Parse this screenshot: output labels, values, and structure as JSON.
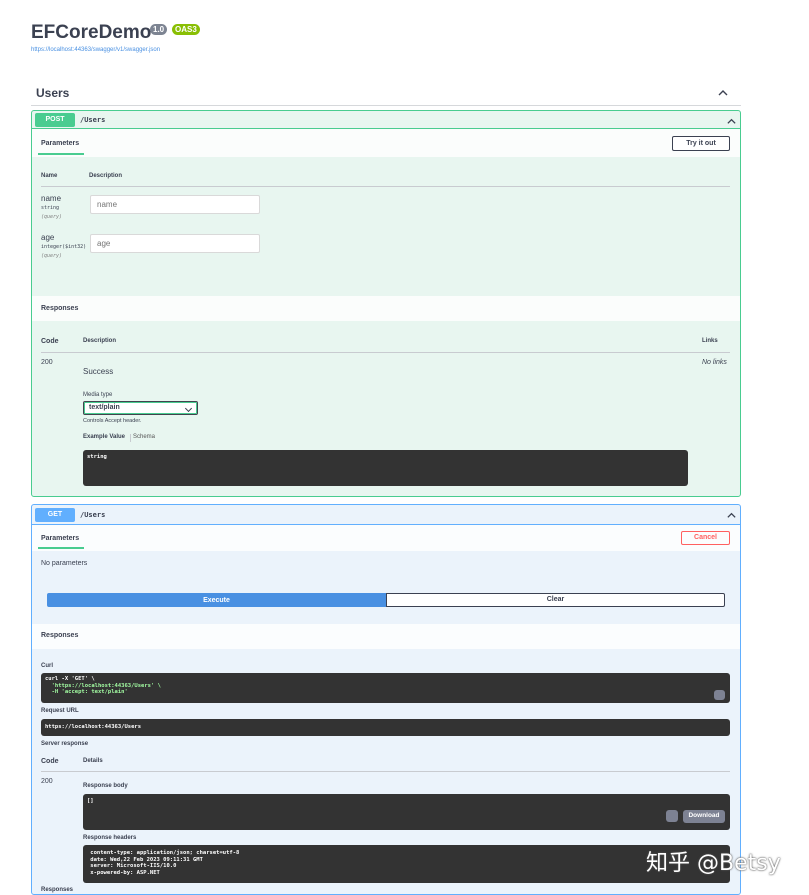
{
  "header": {
    "title": "EFCoreDemo",
    "version_badge": "1.0",
    "oas_badge": "OAS3",
    "spec_url": "https://localhost:44363/swagger/v1/swagger.json"
  },
  "tag": {
    "name": "Users"
  },
  "post_op": {
    "method": "POST",
    "path": "/Users",
    "params_tab": "Parameters",
    "try_button": "Try it out",
    "col_name": "Name",
    "col_description": "Description",
    "params": [
      {
        "name": "name",
        "type": "string",
        "in": "(query)",
        "placeholder": "name"
      },
      {
        "name": "age",
        "type": "integer($int32)",
        "in": "(query)",
        "placeholder": "age"
      }
    ],
    "responses_title": "Responses",
    "col_code": "Code",
    "col_resp_description": "Description",
    "col_links": "Links",
    "response": {
      "code": "200",
      "description": "Success",
      "links": "No links",
      "media_type_label": "Media type",
      "media_type_value": "text/plain",
      "controls_hint": "Controls Accept header.",
      "example_tab": "Example Value",
      "schema_tab": "Schema",
      "example": "string"
    }
  },
  "get_op": {
    "method": "GET",
    "path": "/Users",
    "params_tab": "Parameters",
    "cancel_button": "Cancel",
    "no_params": "No parameters",
    "execute_button": "Execute",
    "clear_button": "Clear",
    "responses_title": "Responses",
    "curl_label": "Curl",
    "curl_line1": "curl -X 'GET' \\",
    "curl_line2": "  'https://localhost:44363/Users' \\",
    "curl_line3": "  -H 'accept: text/plain'",
    "request_url_label": "Request URL",
    "request_url": "https://localhost:44363/Users",
    "server_response_label": "Server response",
    "col_code": "Code",
    "col_details": "Details",
    "code": "200",
    "response_body_label": "Response body",
    "response_body": "[]",
    "download_button": "Download",
    "response_headers_label": "Response headers",
    "headers_line1": " content-type: application/json; charset=utf-8",
    "headers_line2": " date: Wed,22 Feb 2023 09:11:31 GMT",
    "headers_line3": " server: Microsoft-IIS/10.0",
    "headers_line4": " x-powered-by: ASP.NET",
    "bottom_responses": "Responses"
  },
  "watermark": "知乎 @Betsy",
  "colors": {
    "post": "#49cc90",
    "get": "#61affe",
    "execute": "#4990e2",
    "cancel": "#ff6060"
  }
}
